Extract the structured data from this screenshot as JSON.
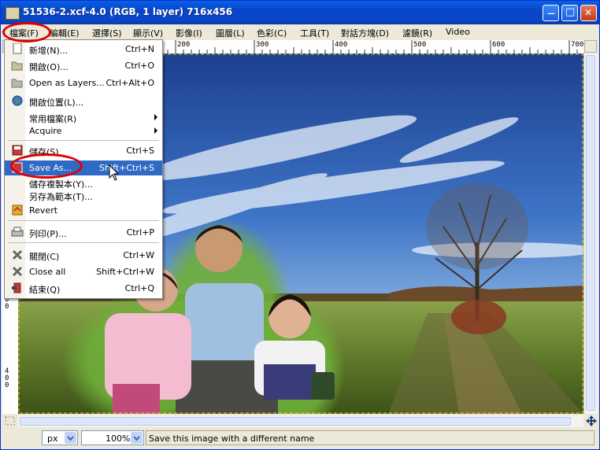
{
  "window": {
    "title": "51536-2.xcf-4.0 (RGB, 1 layer) 716x456",
    "minimize_glyph": "—",
    "maximize_glyph": "□",
    "close_glyph": "✕"
  },
  "menubar": {
    "items": [
      {
        "label": "檔案(F)"
      },
      {
        "label": "編輯(E)"
      },
      {
        "label": "選擇(S)"
      },
      {
        "label": "顯示(V)"
      },
      {
        "label": "影像(I)"
      },
      {
        "label": "圖層(L)"
      },
      {
        "label": "色彩(C)"
      },
      {
        "label": "工具(T)"
      },
      {
        "label": "對話方塊(D)"
      },
      {
        "label": "濾鏡(R)"
      },
      {
        "label": "Video"
      }
    ]
  },
  "ruler": {
    "h_ticks": [
      "200",
      "300",
      "400",
      "500",
      "600",
      "700"
    ],
    "v_ticks": [
      "3\n0\n0",
      "4\n0\n0"
    ]
  },
  "file_menu": {
    "items": [
      {
        "label": "新增(N)...",
        "shortcut": "Ctrl+N",
        "icon": "new-document-icon"
      },
      {
        "label": "開啟(O)...",
        "shortcut": "Ctrl+O",
        "icon": "open-folder-icon"
      },
      {
        "label": "Open as Layers...",
        "shortcut": "Ctrl+Alt+O",
        "icon": "open-layers-icon"
      },
      {
        "label": "開啟位置(L)...",
        "shortcut": "",
        "icon": "globe-icon"
      },
      {
        "label": "常用檔案(R)",
        "shortcut": "",
        "icon": "",
        "submenu": true
      },
      {
        "label": "Acquire",
        "shortcut": "",
        "icon": "",
        "submenu": true
      },
      {
        "label": "儲存(S)",
        "shortcut": "Ctrl+S",
        "icon": "save-icon"
      },
      {
        "label": "Save As...",
        "shortcut": "Shift+Ctrl+S",
        "icon": "save-as-icon",
        "highlighted": true
      },
      {
        "label": "儲存複製本(Y)...",
        "shortcut": "",
        "icon": ""
      },
      {
        "label": "另存為範本(T)...",
        "shortcut": "",
        "icon": ""
      },
      {
        "label": "Revert",
        "shortcut": "",
        "icon": "revert-icon"
      },
      {
        "label": "列印(P)...",
        "shortcut": "Ctrl+P",
        "icon": "print-icon"
      },
      {
        "label": "關閉(C)",
        "shortcut": "Ctrl+W",
        "icon": "close-x-icon"
      },
      {
        "label": "Close all",
        "shortcut": "Shift+Ctrl+W",
        "icon": "close-all-icon"
      },
      {
        "label": "結束(Q)",
        "shortcut": "Ctrl+Q",
        "icon": "quit-icon"
      }
    ]
  },
  "statusbar": {
    "unit": "px",
    "zoom": "100%",
    "message": "Save this image with a different name"
  },
  "colors": {
    "highlight": "#316ac5",
    "annotation_red": "#e00000"
  }
}
